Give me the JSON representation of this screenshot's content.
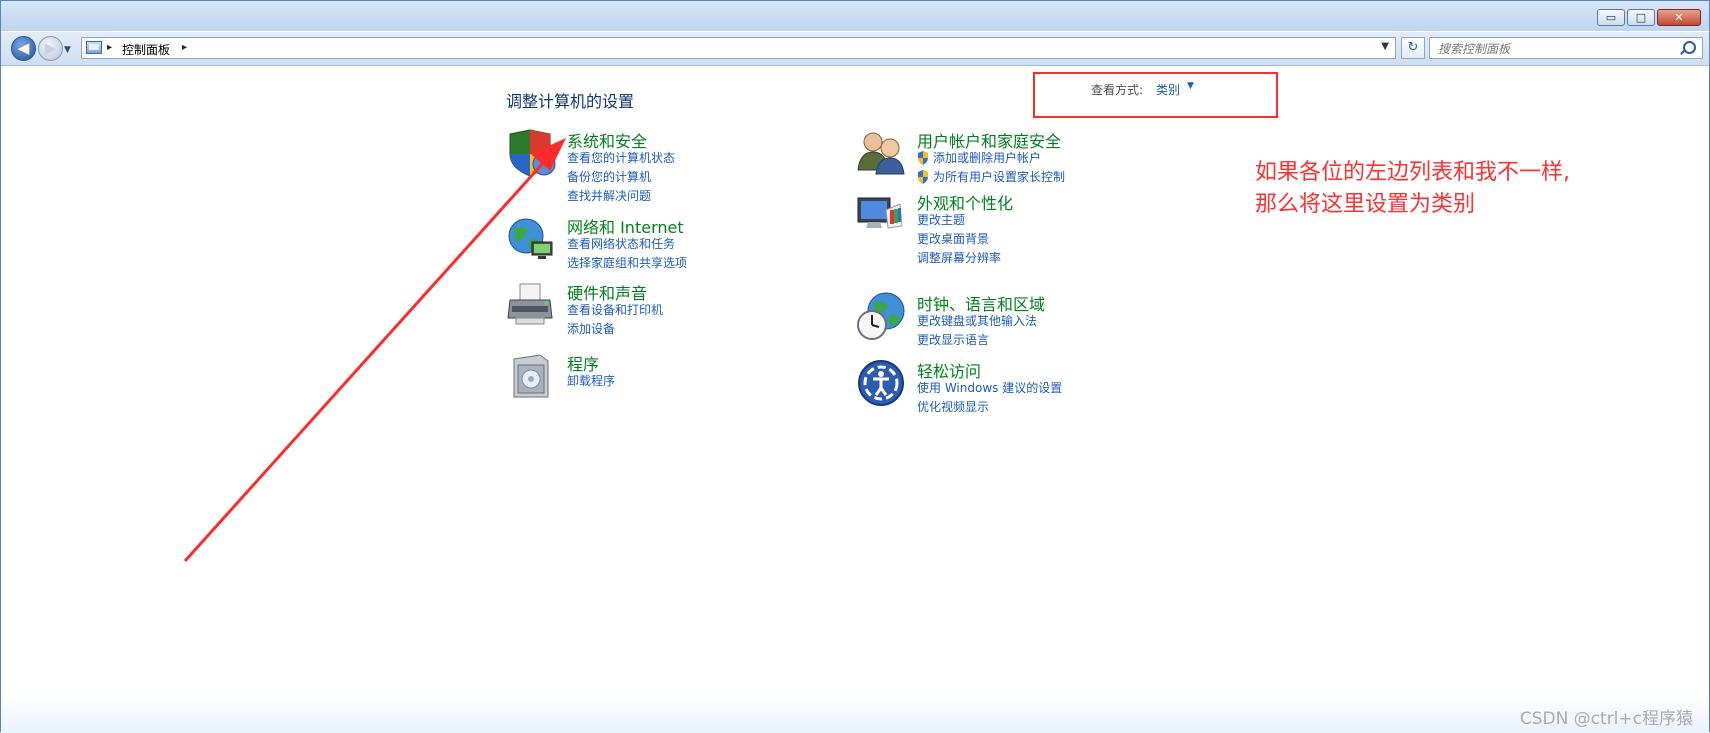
{
  "window": {
    "minimize": "▭",
    "maximize": "□",
    "close": "✕"
  },
  "nav": {
    "back": "◀",
    "forward": "▶",
    "recent": "▼"
  },
  "address": {
    "sep1": "▸",
    "crumb": "控制面板",
    "sep2": "▸",
    "dropdown": "▼",
    "refresh": "↻"
  },
  "search": {
    "placeholder": "搜索控制面板"
  },
  "page": {
    "title": "调整计算机的设置",
    "view_label": "查看方式:",
    "view_value": "类别",
    "view_caret": "▼"
  },
  "categories": [
    {
      "title": "系统和安全",
      "icon": "shield-icon",
      "links": [
        "查看您的计算机状态",
        "备份您的计算机",
        "查找并解决问题"
      ]
    },
    {
      "title": "网络和 Internet",
      "icon": "network-globe-icon",
      "links": [
        "查看网络状态和任务",
        "选择家庭组和共享选项"
      ]
    },
    {
      "title": "硬件和声音",
      "icon": "printer-icon",
      "links": [
        "查看设备和打印机",
        "添加设备"
      ]
    },
    {
      "title": "程序",
      "icon": "programs-box-icon",
      "links": [
        "卸载程序"
      ]
    },
    {
      "title": "用户帐户和家庭安全",
      "icon": "users-icon",
      "links": [
        "添加或删除用户帐户",
        "为所有用户设置家长控制"
      ]
    },
    {
      "title": "外观和个性化",
      "icon": "monitor-palette-icon",
      "links": [
        "更改主题",
        "更改桌面背景",
        "调整屏幕分辨率"
      ]
    },
    {
      "title": "时钟、语言和区域",
      "icon": "clock-globe-icon",
      "links": [
        "更改键盘或其他输入法",
        "更改显示语言"
      ]
    },
    {
      "title": "轻松访问",
      "icon": "accessibility-icon",
      "links": [
        "使用 Windows 建议的设置",
        "优化视频显示"
      ]
    }
  ],
  "annotation": {
    "line1": "如果各位的左边列表和我不一样,",
    "line2": "那么将这里设置为类别",
    "color": "#ff3030"
  },
  "watermark": "CSDN @ctrl+c程序猿"
}
